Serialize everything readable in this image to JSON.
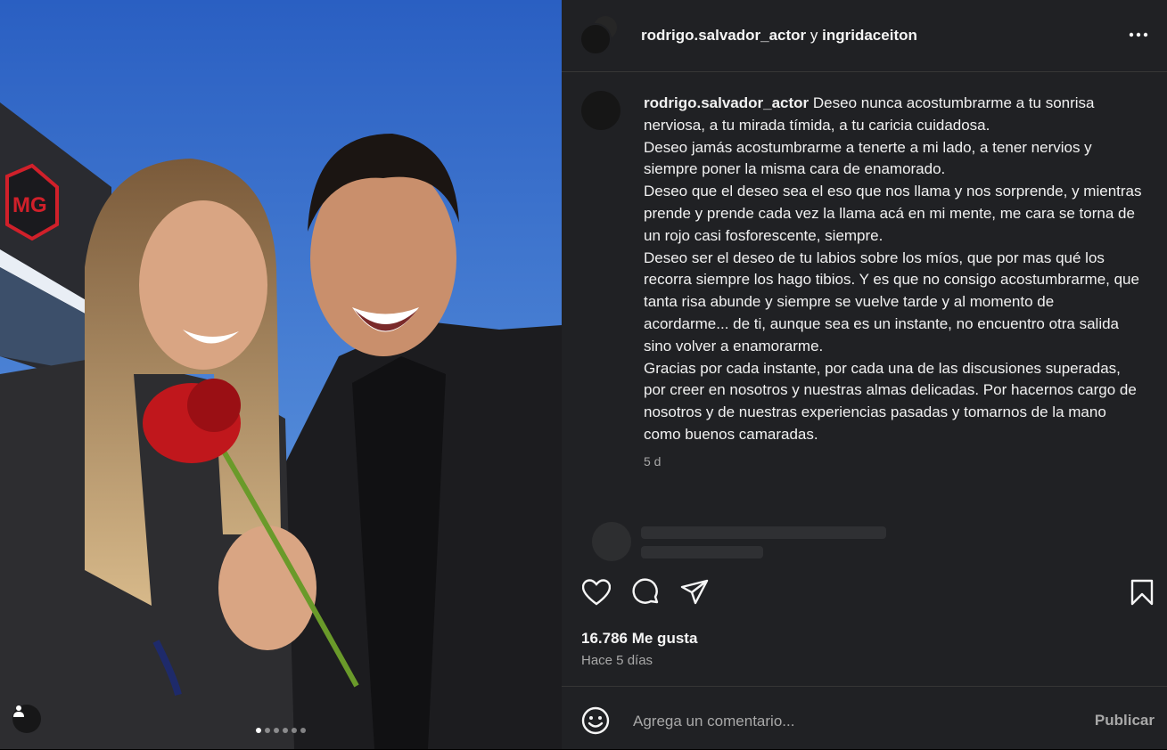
{
  "header": {
    "owner_1": "rodrigo.salvador_actor",
    "joiner": "y",
    "owner_2": "ingridaceiton",
    "more_icon": "more-horizontal-icon"
  },
  "caption": {
    "username": "rodrigo.salvador_actor",
    "paragraphs": [
      "Deseo nunca acostumbrarme a tu sonrisa nerviosa, a tu mirada tímida, a tu caricia cuidadosa.",
      "Deseo jamás acostumbrarme a tenerte a mi lado, a tener nervios y siempre poner la misma cara de enamorado.",
      "Deseo que el deseo sea el eso que nos llama y nos sorprende, y mientras prende y prende cada vez la llama acá en mi mente, me cara se torna de un rojo casi fosforescente, siempre.",
      "Deseo ser el deseo de tu labios sobre los míos, que por mas qué los recorra siempre los hago tibios. Y es que no consigo acostumbrarme, que tanta risa abunde y siempre se vuelve tarde y al momento de acordarme... de ti, aunque sea es un instante, no encuentro otra salida sino volver a enamorarme.",
      "Gracias por cada instante, por cada una de las discusiones superadas, por creer en nosotros y nuestras almas delicadas. Por hacernos cargo de nosotros y de nuestras experiencias pasadas y tomarnos de la mano como buenos camaradas."
    ],
    "time": "5 d"
  },
  "actions": {
    "like_icon": "heart-icon",
    "comment_icon": "comment-icon",
    "share_icon": "send-icon",
    "save_icon": "bookmark-icon"
  },
  "likes_text": "16.786 Me gusta",
  "posted_ago": "Hace 5 días",
  "comment": {
    "placeholder": "Agrega un comentario...",
    "publish_label": "Publicar",
    "emoji_icon": "emoji-icon"
  },
  "media": {
    "carousel_count": 6,
    "carousel_active": 1,
    "tag_icon": "user-tag-icon",
    "brand_logo_text": "MG"
  },
  "colors": {
    "panel_bg": "#202124",
    "text_secondary": "#a8a8a8"
  }
}
